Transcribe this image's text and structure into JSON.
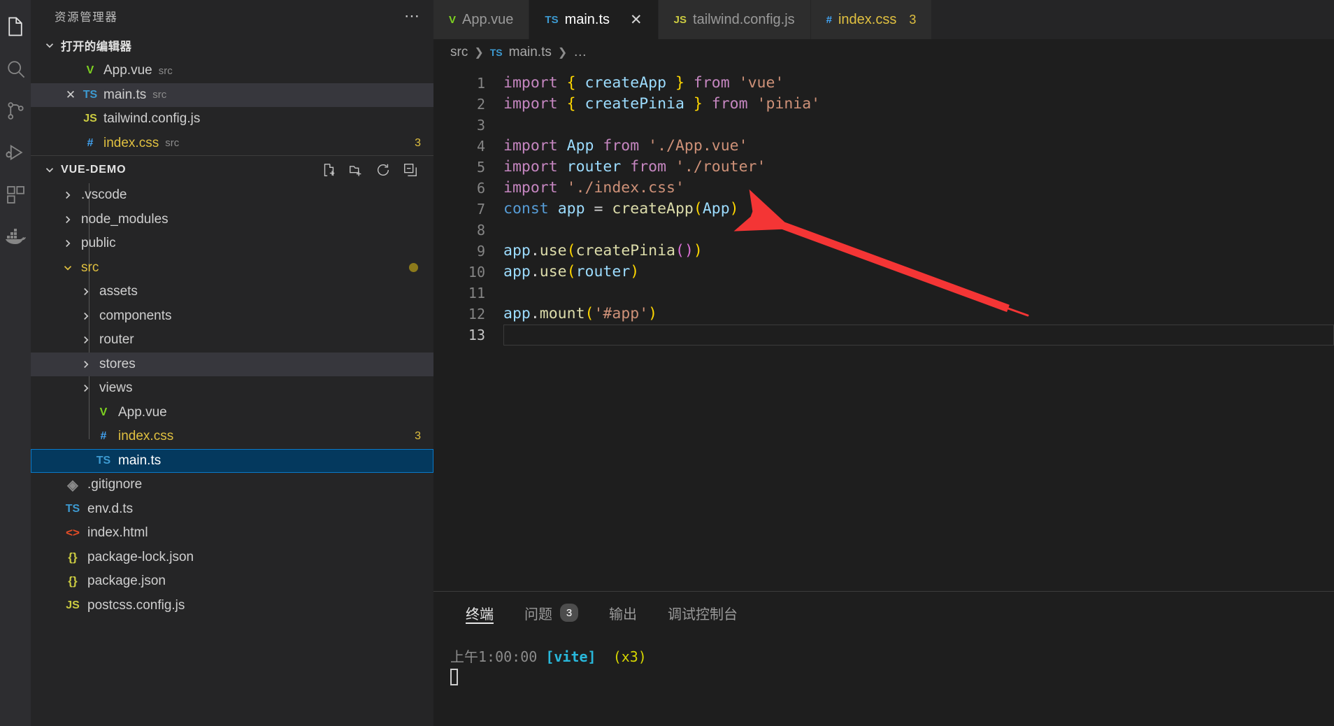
{
  "activity_bar": {
    "items": [
      {
        "name": "explorer",
        "icon": "files-icon",
        "active": true
      },
      {
        "name": "search",
        "icon": "search-icon",
        "active": false
      },
      {
        "name": "source-control",
        "icon": "source-control-icon",
        "active": false
      },
      {
        "name": "run-debug",
        "icon": "run-debug-icon",
        "active": false
      },
      {
        "name": "extensions",
        "icon": "extensions-icon",
        "active": false
      },
      {
        "name": "docker",
        "icon": "docker-icon",
        "active": false
      }
    ]
  },
  "sidebar": {
    "title": "资源管理器",
    "more_actions": "⋯",
    "open_editors": {
      "label": "打开的编辑器",
      "items": [
        {
          "name": "App.vue",
          "folder": "src",
          "icon": "vue-file-icon",
          "icon_glyph": "V",
          "state": "normal"
        },
        {
          "name": "main.ts",
          "folder": "src",
          "icon": "ts-file-icon",
          "icon_glyph": "TS",
          "state": "hover",
          "close": "✕"
        },
        {
          "name": "tailwind.config.js",
          "folder": "",
          "icon": "js-file-icon",
          "icon_glyph": "JS",
          "state": "normal"
        },
        {
          "name": "index.css",
          "folder": "src",
          "icon": "css-file-icon",
          "icon_glyph": "#",
          "state": "normal",
          "badge": "3"
        }
      ]
    },
    "project": {
      "label": "VUE-DEMO",
      "actions": [
        "new-file-icon",
        "new-folder-icon",
        "refresh-icon",
        "collapse-all-icon"
      ],
      "tree": [
        {
          "name": ".vscode",
          "type": "folder",
          "depth": 1,
          "expanded": false
        },
        {
          "name": "node_modules",
          "type": "folder",
          "depth": 1,
          "expanded": false
        },
        {
          "name": "public",
          "type": "folder",
          "depth": 1,
          "expanded": false
        },
        {
          "name": "src",
          "type": "folder",
          "depth": 1,
          "expanded": true,
          "modified": true
        },
        {
          "name": "assets",
          "type": "folder",
          "depth": 2,
          "expanded": false
        },
        {
          "name": "components",
          "type": "folder",
          "depth": 2,
          "expanded": false
        },
        {
          "name": "router",
          "type": "folder",
          "depth": 2,
          "expanded": false
        },
        {
          "name": "stores",
          "type": "folder",
          "depth": 2,
          "expanded": false,
          "state": "hover"
        },
        {
          "name": "views",
          "type": "folder",
          "depth": 2,
          "expanded": false
        },
        {
          "name": "App.vue",
          "type": "file",
          "depth": 2,
          "icon": "vue-file-icon",
          "icon_glyph": "V"
        },
        {
          "name": "index.css",
          "type": "file",
          "depth": 2,
          "icon": "css-file-icon",
          "icon_glyph": "#",
          "badge": "3"
        },
        {
          "name": "main.ts",
          "type": "file",
          "depth": 2,
          "icon": "ts-file-icon",
          "icon_glyph": "TS",
          "state": "selected"
        },
        {
          "name": ".gitignore",
          "type": "file",
          "depth": 1,
          "icon": "git-file-icon",
          "icon_glyph": "◈"
        },
        {
          "name": "env.d.ts",
          "type": "file",
          "depth": 1,
          "icon": "ts-file-icon",
          "icon_glyph": "TS"
        },
        {
          "name": "index.html",
          "type": "file",
          "depth": 1,
          "icon": "html-file-icon",
          "icon_glyph": "<>"
        },
        {
          "name": "package-lock.json",
          "type": "file",
          "depth": 1,
          "icon": "json-file-icon",
          "icon_glyph": "{}"
        },
        {
          "name": "package.json",
          "type": "file",
          "depth": 1,
          "icon": "json-file-icon",
          "icon_glyph": "{}"
        },
        {
          "name": "postcss.config.js",
          "type": "file",
          "depth": 1,
          "icon": "js-file-icon",
          "icon_glyph": "JS"
        }
      ]
    }
  },
  "editor": {
    "tabs": [
      {
        "label": "App.vue",
        "icon_glyph": "V",
        "icon": "vue-file-icon",
        "active": false
      },
      {
        "label": "main.ts",
        "icon_glyph": "TS",
        "icon": "ts-file-icon",
        "active": true,
        "close": "✕"
      },
      {
        "label": "tailwind.config.js",
        "icon_glyph": "JS",
        "icon": "js-file-icon",
        "active": false
      },
      {
        "label": "index.css",
        "icon_glyph": "#",
        "icon": "css-file-icon",
        "active": false,
        "badge": "3"
      }
    ],
    "breadcrumb": {
      "folder": "src",
      "file": "main.ts",
      "file_icon_glyph": "TS",
      "ellipsis": "…",
      "sep": "❯"
    },
    "lines": [
      {
        "n": "1",
        "tokens": [
          {
            "t": "import",
            "c": "k"
          },
          {
            "t": " ",
            "c": "op"
          },
          {
            "t": "{",
            "c": "y"
          },
          {
            "t": " ",
            "c": "op"
          },
          {
            "t": "createApp",
            "c": "v"
          },
          {
            "t": " ",
            "c": "op"
          },
          {
            "t": "}",
            "c": "y"
          },
          {
            "t": " ",
            "c": "op"
          },
          {
            "t": "from",
            "c": "k"
          },
          {
            "t": " ",
            "c": "op"
          },
          {
            "t": "'vue'",
            "c": "s"
          }
        ]
      },
      {
        "n": "2",
        "tokens": [
          {
            "t": "import",
            "c": "k"
          },
          {
            "t": " ",
            "c": "op"
          },
          {
            "t": "{",
            "c": "y"
          },
          {
            "t": " ",
            "c": "op"
          },
          {
            "t": "createPinia",
            "c": "v"
          },
          {
            "t": " ",
            "c": "op"
          },
          {
            "t": "}",
            "c": "y"
          },
          {
            "t": " ",
            "c": "op"
          },
          {
            "t": "from",
            "c": "k"
          },
          {
            "t": " ",
            "c": "op"
          },
          {
            "t": "'pinia'",
            "c": "s"
          }
        ]
      },
      {
        "n": "3",
        "tokens": []
      },
      {
        "n": "4",
        "tokens": [
          {
            "t": "import",
            "c": "k"
          },
          {
            "t": " ",
            "c": "op"
          },
          {
            "t": "App",
            "c": "v"
          },
          {
            "t": " ",
            "c": "op"
          },
          {
            "t": "from",
            "c": "k"
          },
          {
            "t": " ",
            "c": "op"
          },
          {
            "t": "'./App.vue'",
            "c": "s"
          }
        ]
      },
      {
        "n": "5",
        "tokens": [
          {
            "t": "import",
            "c": "k"
          },
          {
            "t": " ",
            "c": "op"
          },
          {
            "t": "router",
            "c": "v"
          },
          {
            "t": " ",
            "c": "op"
          },
          {
            "t": "from",
            "c": "k"
          },
          {
            "t": " ",
            "c": "op"
          },
          {
            "t": "'./router'",
            "c": "s"
          }
        ]
      },
      {
        "n": "6",
        "tokens": [
          {
            "t": "import",
            "c": "k"
          },
          {
            "t": " ",
            "c": "op"
          },
          {
            "t": "'./index.css'",
            "c": "s"
          }
        ]
      },
      {
        "n": "7",
        "tokens": [
          {
            "t": "const",
            "c": "kb"
          },
          {
            "t": " ",
            "c": "op"
          },
          {
            "t": "app",
            "c": "v"
          },
          {
            "t": " ",
            "c": "op"
          },
          {
            "t": "=",
            "c": "op"
          },
          {
            "t": " ",
            "c": "op"
          },
          {
            "t": "createApp",
            "c": "f"
          },
          {
            "t": "(",
            "c": "y"
          },
          {
            "t": "App",
            "c": "v"
          },
          {
            "t": ")",
            "c": "y"
          }
        ]
      },
      {
        "n": "8",
        "tokens": []
      },
      {
        "n": "9",
        "tokens": [
          {
            "t": "app",
            "c": "v"
          },
          {
            "t": ".",
            "c": "op"
          },
          {
            "t": "use",
            "c": "f"
          },
          {
            "t": "(",
            "c": "y"
          },
          {
            "t": "createPinia",
            "c": "f"
          },
          {
            "t": "(",
            "c": "p2"
          },
          {
            "t": ")",
            "c": "p2"
          },
          {
            "t": ")",
            "c": "y"
          }
        ]
      },
      {
        "n": "10",
        "tokens": [
          {
            "t": "app",
            "c": "v"
          },
          {
            "t": ".",
            "c": "op"
          },
          {
            "t": "use",
            "c": "f"
          },
          {
            "t": "(",
            "c": "y"
          },
          {
            "t": "router",
            "c": "v"
          },
          {
            "t": ")",
            "c": "y"
          }
        ]
      },
      {
        "n": "11",
        "tokens": []
      },
      {
        "n": "12",
        "tokens": [
          {
            "t": "app",
            "c": "v"
          },
          {
            "t": ".",
            "c": "op"
          },
          {
            "t": "mount",
            "c": "f"
          },
          {
            "t": "(",
            "c": "y"
          },
          {
            "t": "'#app'",
            "c": "s"
          },
          {
            "t": ")",
            "c": "y"
          }
        ]
      },
      {
        "n": "13",
        "tokens": [],
        "current": true
      }
    ],
    "annotation": {
      "type": "arrow",
      "color": "#f43535",
      "points_at": "line-6-import-index-css"
    }
  },
  "panel": {
    "tabs": [
      {
        "label": "终端",
        "active": true
      },
      {
        "label": "问题",
        "active": false,
        "badge": "3"
      },
      {
        "label": "输出",
        "active": false
      },
      {
        "label": "调试控制台",
        "active": false
      }
    ],
    "terminal": {
      "timestamp": "上午1:00:00",
      "tag": "[vite]",
      "count": "(x3)"
    }
  },
  "colors": {
    "accent": "#0a7aca",
    "selection": "#04395e",
    "annotation_red": "#f43535",
    "warning_yellow": "#e0c040",
    "sidebar_bg": "#252526",
    "editor_bg": "#1e1e1e"
  }
}
